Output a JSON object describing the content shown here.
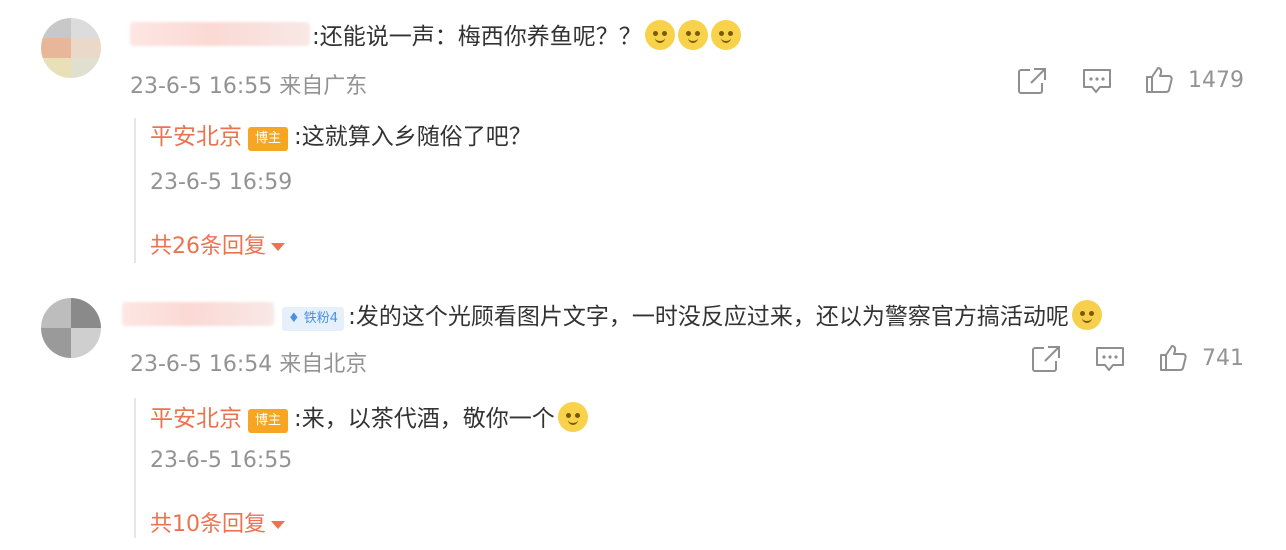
{
  "comments": [
    {
      "text": ":还能说一声：梅西你养鱼呢？？",
      "emoji_icon": "doge-emoji-icon",
      "time": "23-6-5 16:55",
      "location": "来自广东",
      "like_count": "1479",
      "avatar_colors": [
        "#c8c8c8",
        "#ead9c8",
        "#dddddd",
        "#e8b79a",
        "#eae0b8",
        "#e0e0d0"
      ],
      "reply": {
        "username": "平安北京",
        "badge": "博主",
        "text": ":这就算入乡随俗了吧？",
        "time": "23-6-5 16:59",
        "expand_label": "共26条回复"
      }
    },
    {
      "badge": "铁粉4",
      "text": ":发的这个光顾看图片文字，一时没反应过来，还以为警察官方搞活动呢",
      "emoji_icon": "laugh-cry-emoji-icon",
      "time": "23-6-5 16:54",
      "location": "来自北京",
      "like_count": "741",
      "avatar_colors": [
        "#bdbdbd",
        "#8a8a8a",
        "#9a9a9a",
        "#cfcfcf"
      ],
      "reply": {
        "username": "平安北京",
        "badge": "博主",
        "text": ":来，以茶代酒，敬你一个",
        "emoji_icon": "doge-emoji-icon",
        "time": "23-6-5 16:55",
        "expand_label": "共10条回复"
      }
    }
  ],
  "colors": {
    "accent": "#eb7350",
    "meta": "#939393",
    "text": "#333333"
  }
}
